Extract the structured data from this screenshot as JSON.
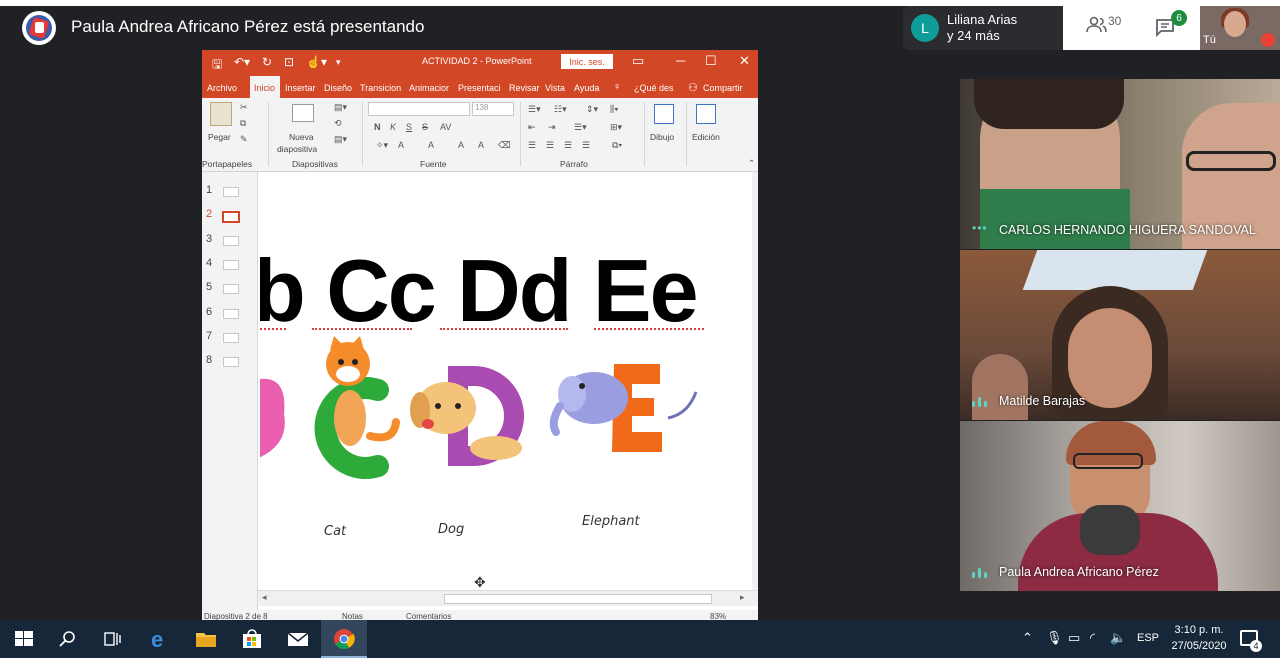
{
  "meet": {
    "presenting_label": "Paula Andrea Africano Pérez está presentando",
    "participant_chip": {
      "avatar_letter": "L",
      "name": "Liliana Arias",
      "more": "y 24 más"
    },
    "people_count": "30",
    "chat_badge": "6",
    "self_label": "Tú"
  },
  "powerpoint": {
    "title": "ACTIVIDAD 2  -  PowerPoint",
    "signin_label": "Inic. ses.",
    "tabs": [
      "Archivo",
      "Inicio",
      "Insertar",
      "Diseño",
      "Transicion",
      "Animacior",
      "Presentaci",
      "Revisar",
      "Vista",
      "Ayuda",
      "¿Qué des",
      "Compartir"
    ],
    "ribbon": {
      "paste_label": "Pegar",
      "new_slide_label1": "Nueva",
      "new_slide_label2": "diapositiva",
      "font_size": "138",
      "draw_label": "Dibujo",
      "edit_label": "Edición",
      "group_clipboard": "Portapapeles",
      "group_slides": "Diapositivas",
      "group_font": "Fuente",
      "group_paragraph": "Párrafo",
      "font_buttons": [
        "N",
        "K",
        "S",
        "S",
        "AV",
        "A",
        "A",
        "A",
        "A"
      ]
    },
    "slide_numbers": [
      "1",
      "2",
      "3",
      "4",
      "5",
      "6",
      "7",
      "8"
    ],
    "selected_slide": 2,
    "slide": {
      "letters": "b Cc Dd Ee",
      "animal_labels": [
        "Cat",
        "Dog",
        "Elephant"
      ]
    },
    "status": {
      "slide_of": "Diapositiva 2 de 8",
      "notes": "Notas",
      "comments": "Comentarios",
      "zoom": "83%"
    }
  },
  "participants": [
    {
      "name": "CARLOS HERNANDO HIGUERA SANDOVAL",
      "indicator": "dots"
    },
    {
      "name": "Matilde Barajas",
      "indicator": "bars"
    },
    {
      "name": "Paula Andrea Africano Pérez",
      "indicator": "bars"
    }
  ],
  "taskbar": {
    "language": "ESP",
    "time": "3:10 p. m.",
    "date": "27/05/2020",
    "notification_count": "4"
  },
  "colors": {
    "ppt_orange": "#d24726",
    "meet_bg": "#202124",
    "taskbar": "#16273a",
    "speaking": "#5fd4c4"
  }
}
